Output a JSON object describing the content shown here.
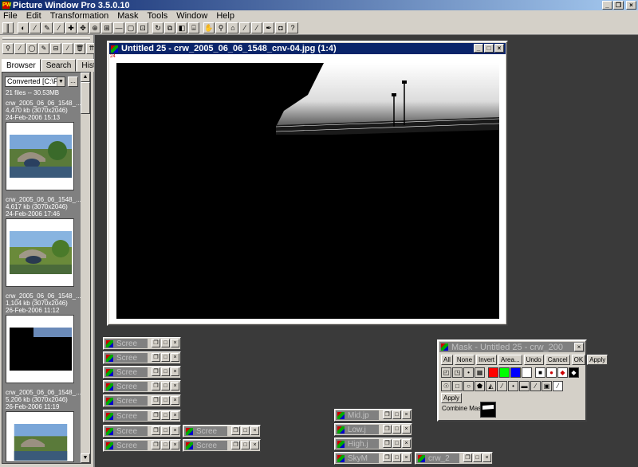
{
  "app": {
    "title": "Picture Window Pro 3.5.0.10",
    "icon_label": "PW",
    "window_buttons": [
      "_",
      "❐",
      "×"
    ]
  },
  "menu": [
    "File",
    "Edit",
    "Transformation",
    "Mask",
    "Tools",
    "Window",
    "Help"
  ],
  "toolbar": {
    "icons": [
      "grip-icon",
      "levels-icon",
      "brush-icon",
      "clone-icon",
      "retouch-icon",
      "stamp-icon",
      "move-icon",
      "center-icon",
      "resize-icon",
      "minus-icon",
      "square-icon",
      "crop-icon",
      "rotate-icon",
      "copy-icon",
      "color-icon",
      "stack-icon",
      "hand-icon",
      "zoom-icon",
      "build-icon",
      "wand-icon",
      "paint-icon",
      "pen-icon",
      "camera-icon",
      "help-icon"
    ],
    "glyphs": [
      "║",
      "◐",
      "⁄",
      "✎",
      "⁄",
      "✚",
      "✥",
      "⊕",
      "⊞",
      "—",
      "▢",
      "⊡",
      "↻",
      "⧉",
      "◧",
      "⌸",
      "✋",
      "⚲",
      "⌂",
      "⁄",
      "⁄",
      "✒",
      "◘",
      "?"
    ]
  },
  "sidebar": {
    "tool_glyphs": [
      "⚲",
      "⁄",
      "◯",
      "✎",
      "⊟",
      "⁄",
      "🗑",
      "⇈"
    ],
    "tabs": [
      "Browser",
      "Search",
      "History"
    ],
    "active_tab": "Browser",
    "folder": "Converted [C:\\Photo",
    "folder_button": "...",
    "summary": "21 files -- 30.53MB",
    "files": [
      {
        "name": "crw_2005_06_06_1548_...",
        "size": "4,470 kb (3070x2046)",
        "date": "24-Feb-2006 15:13"
      },
      {
        "name": "crw_2005_06_06_1548_...",
        "size": "4,617 kb (3070x2046)",
        "date": "24-Feb-2006 17:46"
      },
      {
        "name": "crw_2005_06_06_1548_...",
        "size": "1,104 kb (3070x2046)",
        "date": "26-Feb-2006 11:12"
      },
      {
        "name": "crw_2005_06_06_1548_...",
        "size": "5,206 kb (3070x2046)",
        "date": "26-Feb-2006 11:19"
      }
    ]
  },
  "image_window": {
    "title": "Untitled 25 - crw_2005_06_06_1548_cnv-04.jpg (1:4)",
    "corner_mark": "24"
  },
  "minimized": [
    {
      "label": "Scree"
    },
    {
      "label": "Scree"
    },
    {
      "label": "Scree"
    },
    {
      "label": "Scree"
    },
    {
      "label": "Scree"
    },
    {
      "label": "Scree"
    },
    {
      "label": "Scree"
    },
    {
      "label": "Scree"
    },
    {
      "label": "Scree"
    },
    {
      "label": "Scree"
    },
    {
      "label": "Mid.jp"
    },
    {
      "label": "Low.j"
    },
    {
      "label": "High.j"
    },
    {
      "label": "SkyM"
    },
    {
      "label": "crw_2"
    }
  ],
  "mask_panel": {
    "title": "Mask - Untitled 25 - crw_200",
    "buttons": [
      "All",
      "None",
      "Invert",
      "Area...",
      "Undo",
      "Cancel",
      "OK",
      "Apply"
    ],
    "apply2": "Apply",
    "combine_label": "Combine Mask:",
    "colors": {
      "red": "#ff0000",
      "green": "#00ff00",
      "blue": "#0000ff",
      "white": "#ffffff"
    }
  }
}
